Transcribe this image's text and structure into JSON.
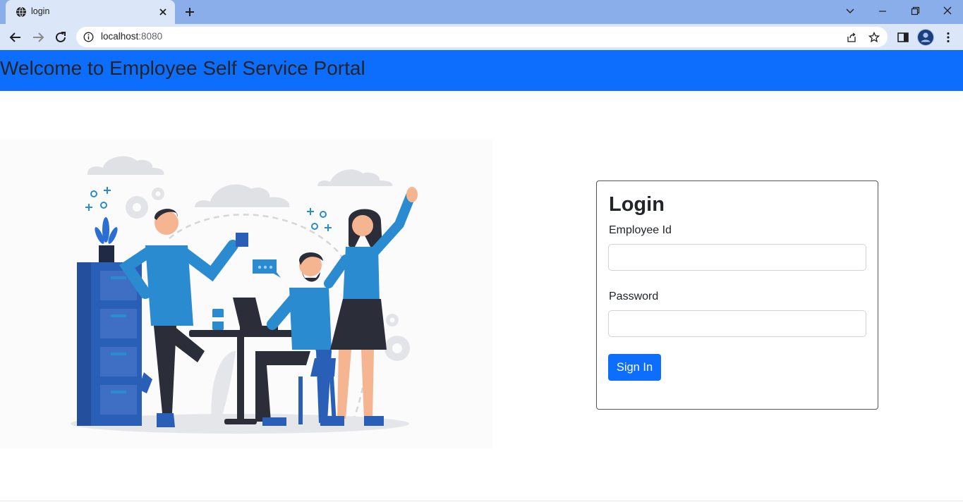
{
  "browser": {
    "tab_title": "login",
    "url_host": "localhost",
    "url_port": ":8080"
  },
  "page": {
    "header_title": "Welcome to Employee Self Service Portal"
  },
  "login": {
    "title": "Login",
    "employee_id_label": "Employee Id",
    "employee_id_value": "",
    "password_label": "Password",
    "password_value": "",
    "submit_label": "Sign In"
  },
  "colors": {
    "primary": "#0d6efd",
    "tabstrip": "#8aaee9",
    "toolbar": "#dbe6f9",
    "illustration_blue": "#2a8bd1"
  }
}
